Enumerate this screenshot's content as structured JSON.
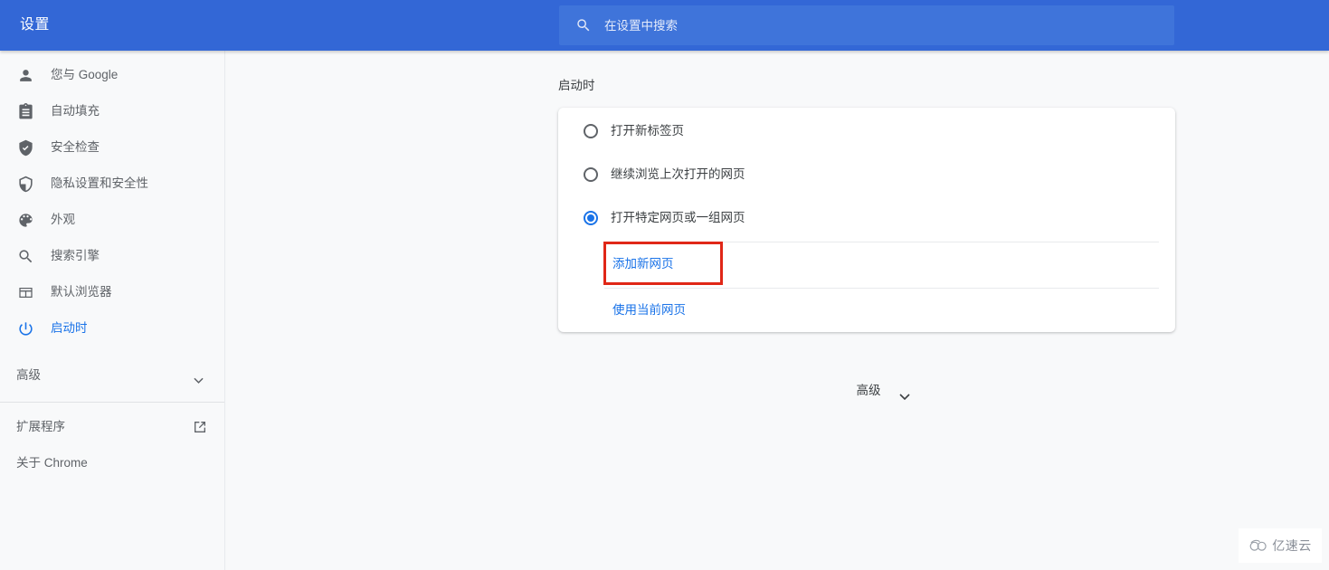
{
  "appbar": {
    "title": "设置",
    "search": {
      "placeholder": "在设置中搜索",
      "value": "",
      "icon": "search-icon"
    },
    "background_color": "#3367d6",
    "search_background_color": "#3f74da"
  },
  "sidebar": {
    "items": [
      {
        "label": "您与 Google",
        "icon": "person-icon",
        "active": false
      },
      {
        "label": "自动填充",
        "icon": "clipboard-icon",
        "active": false
      },
      {
        "label": "安全检查",
        "icon": "shield-check-filled-icon",
        "active": false
      },
      {
        "label": "隐私设置和安全性",
        "icon": "shield-outline-icon",
        "active": false
      },
      {
        "label": "外观",
        "icon": "palette-icon",
        "active": false
      },
      {
        "label": "搜索引擎",
        "icon": "search-icon",
        "active": false
      },
      {
        "label": "默认浏览器",
        "icon": "browser-window-icon",
        "active": false
      },
      {
        "label": "启动时",
        "icon": "power-icon",
        "active": true
      }
    ],
    "advanced": {
      "label": "高级",
      "icon": "chevron-down-icon",
      "expanded": false
    },
    "footer_items": [
      {
        "label": "扩展程序",
        "icon": "external-link-icon"
      },
      {
        "label": "关于 Chrome",
        "icon": ""
      }
    ],
    "active_color": "#1a73e8",
    "text_color": "#5f6368"
  },
  "main": {
    "section_title": "启动时",
    "startup_options": [
      {
        "label": "打开新标签页",
        "selected": false
      },
      {
        "label": "继续浏览上次打开的网页",
        "selected": false
      },
      {
        "label": "打开特定网页或一组网页",
        "selected": true
      }
    ],
    "sub_actions": [
      {
        "label": "添加新网页",
        "highlighted": true
      },
      {
        "label": "使用当前网页",
        "highlighted": false
      }
    ],
    "advanced_toggle": {
      "label": "高级",
      "icon": "chevron-down-icon"
    },
    "highlight_color": "#e02717",
    "link_color": "#1a73e8"
  },
  "watermark": {
    "text": "亿速云",
    "icon": "cloud-icon",
    "color": "#8a8f98"
  }
}
